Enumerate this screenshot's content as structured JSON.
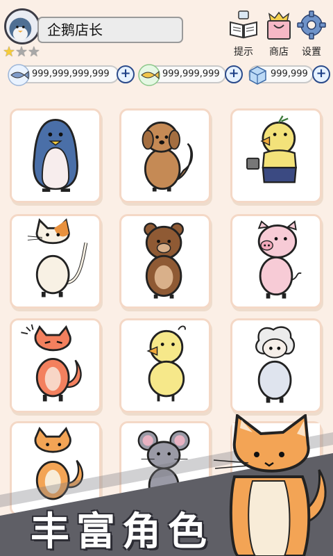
{
  "profile": {
    "name": "企鹅店长",
    "stars_filled": 1,
    "stars_total": 3
  },
  "top_buttons": [
    {
      "id": "hint",
      "label": "提示",
      "icon": "book-teacup-icon"
    },
    {
      "id": "shop",
      "label": "商店",
      "icon": "shopping-bag-icon"
    },
    {
      "id": "settings",
      "label": "设置",
      "icon": "gear-icon"
    }
  ],
  "currencies": [
    {
      "icon": "fish-icon",
      "value": "999,999,999,999"
    },
    {
      "icon": "gold-fish-icon",
      "value": "999,999,999"
    },
    {
      "icon": "ice-cube-icon",
      "value": "999,999"
    }
  ],
  "characters": [
    {
      "name": "penguin",
      "icon": "penguin-icon"
    },
    {
      "name": "dog",
      "icon": "dog-icon"
    },
    {
      "name": "chick-with-bucket",
      "icon": "chick-bucket-icon"
    },
    {
      "name": "cat",
      "icon": "cat-icon"
    },
    {
      "name": "bear",
      "icon": "bear-icon"
    },
    {
      "name": "pig",
      "icon": "pig-icon"
    },
    {
      "name": "angry-fox",
      "icon": "angry-fox-icon"
    },
    {
      "name": "duckling",
      "icon": "duckling-icon"
    },
    {
      "name": "sheep",
      "icon": "sheep-icon"
    },
    {
      "name": "fox",
      "icon": "fox-icon"
    },
    {
      "name": "mouse",
      "icon": "mouse-icon"
    },
    {
      "name": "hidden",
      "icon": "card-back-icon"
    }
  ],
  "banner": {
    "text": "丰富角色"
  },
  "colors": {
    "background": "#fbefe6",
    "card_border": "#f4d8c6",
    "banner": "#5f5f66",
    "fox_orange": "#f3a455"
  }
}
